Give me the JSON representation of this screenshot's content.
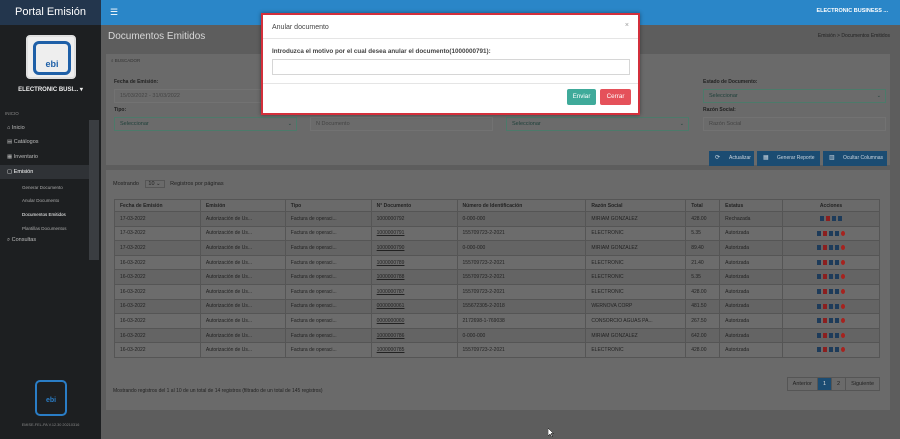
{
  "app": {
    "title": "Portal Emisión",
    "user_menu": "ELECTRONIC BUSINESS ..."
  },
  "sidebar": {
    "company": "ELECTRONIC BUSI... ▾",
    "logo_text": "ebi",
    "section_label": "INICIO",
    "items": [
      {
        "label": "Inicio",
        "icon": "home-icon"
      },
      {
        "label": "Catálogos",
        "icon": "book-icon"
      },
      {
        "label": "Inventario",
        "icon": "cubes-icon"
      },
      {
        "label": "Emisión",
        "icon": "document-icon"
      },
      {
        "label": "Consultas",
        "icon": "search-icon"
      }
    ],
    "subitems": [
      "Generar Documento",
      "Anular Documento",
      "Documentos Emitidos",
      "Plantillas Documentos"
    ],
    "version": "EMISE-FEL-PA V.12.30 20210316"
  },
  "page": {
    "title": "Documentos Emitidos",
    "breadcrumb": "Emisión > Documentos Emitidos",
    "filter_header": "BUSCADOR",
    "fecha_label": "Fecha de Emisión:",
    "fecha_value": "15/03/2022 - 31/03/2022",
    "estado_label": "Estado de Documento:",
    "estado_value": "Seleccionar",
    "tipo_label": "Tipo:",
    "tipo_value": "Seleccionar",
    "ndoc_placeholder": "N Documento",
    "tercero_value": "Seleccionar",
    "razon_label": "Razón Social:",
    "razon_placeholder": "Razón Social",
    "btn_actualizar": "Actualizar",
    "btn_reporte": "Generar Reporte",
    "btn_columnas": "Ocultar Columnas"
  },
  "table": {
    "show_prefix": "Mostrando",
    "show_value": "10",
    "show_suffix": "Registros por páginas",
    "headers": [
      "Fecha de Emisión",
      "Emisión",
      "Tipo",
      "N° Documento",
      "Número de Identificación",
      "Razón Social",
      "Total",
      "Estatus",
      "Acciones"
    ],
    "rows": [
      [
        "17-03-2022",
        "Autorización de Us...",
        "Factura de operaci...",
        "1000000792",
        "0-000-000",
        "MIRIAM GONZALEZ",
        "428.00",
        "Rechazada"
      ],
      [
        "17-03-2022",
        "Autorización de Us...",
        "Factura de operaci...",
        "1000000791",
        "155709723-2-2021",
        "ELECTRONIC",
        "5.35",
        "Autorizada"
      ],
      [
        "17-03-2022",
        "Autorización de Us...",
        "Factura de operaci...",
        "1000000790",
        "0-000-000",
        "MIRIAM GONZALEZ",
        "89.40",
        "Autorizada"
      ],
      [
        "16-03-2022",
        "Autorización de Us...",
        "Factura de operaci...",
        "1000000789",
        "155709723-2-2021",
        "ELECTRONIC",
        "21.40",
        "Autorizada"
      ],
      [
        "16-03-2022",
        "Autorización de Us...",
        "Factura de operaci...",
        "1000000788",
        "155709723-2-2021",
        "ELECTRONIC",
        "5.35",
        "Autorizada"
      ],
      [
        "16-03-2022",
        "Autorización de Us...",
        "Factura de operaci...",
        "1000000787",
        "155709723-2-2021",
        "ELECTRONIC",
        "428.00",
        "Autorizada"
      ],
      [
        "16-03-2022",
        "Autorización de Us...",
        "Factura de operaci...",
        "0000000061",
        "155672305-2-2018",
        "WERNOVA CORP",
        "481.50",
        "Autorizada"
      ],
      [
        "16-03-2022",
        "Autorización de Us...",
        "Factura de operaci...",
        "0000000060",
        "2172698-1-769038",
        "CONSORCIO AGUAS PA...",
        "267.50",
        "Autorizada"
      ],
      [
        "16-03-2022",
        "Autorización de Us...",
        "Factura de operaci...",
        "1000000786",
        "0-000-000",
        "MIRIAM GONZALEZ",
        "642.00",
        "Autorizada"
      ],
      [
        "16-03-2022",
        "Autorización de Us...",
        "Factura de operaci...",
        "1000000785",
        "155709723-2-2021",
        "ELECTRONIC",
        "428.00",
        "Autorizada"
      ]
    ],
    "info": "Mostrando registros del 1 al 10 de un total de 14 registros (filtrado de un total de 145 registros)",
    "pager": {
      "prev": "Anterior",
      "p1": "1",
      "p2": "2",
      "next": "Siguiente"
    }
  },
  "modal": {
    "title": "Anular documento",
    "close": "×",
    "label": "Introduzca el motivo por el cual desea anular el documento(1000000791):",
    "input_value": "",
    "send": "Enviar",
    "cancel": "Cerrar"
  }
}
